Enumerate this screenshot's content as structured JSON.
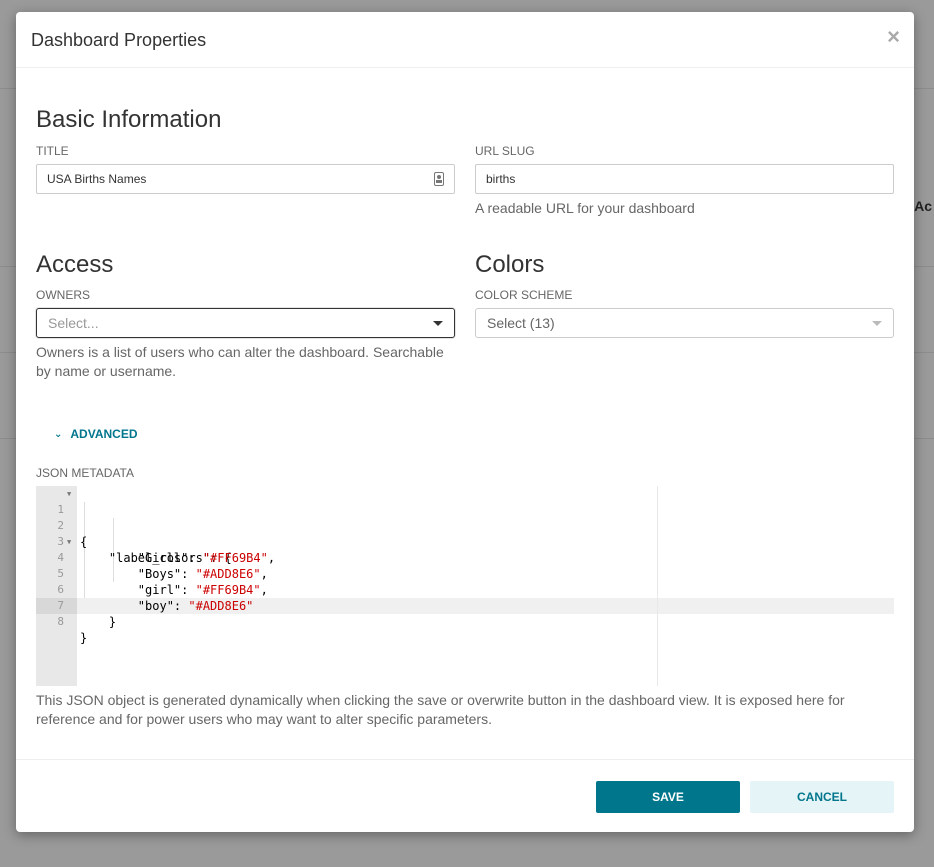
{
  "modal": {
    "title": "Dashboard Properties",
    "close_symbol": "×"
  },
  "background": {
    "partial_text": "Ac"
  },
  "basic_info": {
    "heading": "Basic Information",
    "title_label": "TITLE",
    "title_value": "USA Births Names",
    "slug_label": "URL SLUG",
    "slug_value": "births",
    "slug_help": "A readable URL for your dashboard"
  },
  "access": {
    "heading": "Access",
    "owners_label": "OWNERS",
    "owners_placeholder": "Select...",
    "owners_help": "Owners is a list of users who can alter the dashboard. Searchable by name or username."
  },
  "colors": {
    "heading": "Colors",
    "scheme_label": "COLOR SCHEME",
    "scheme_value": "Select (13)"
  },
  "advanced": {
    "toggle_label": "ADVANCED",
    "json_label": "JSON METADATA",
    "json_lines": [
      "{",
      "    \"label_colors\": {",
      "        \"Girls\": \"#FF69B4\",",
      "        \"Boys\": \"#ADD8E6\",",
      "        \"girl\": \"#FF69B4\",",
      "        \"boy\": \"#ADD8E6\"",
      "    }",
      "}"
    ],
    "json_help": "This JSON object is generated dynamically when clicking the save or overwrite button in the dashboard view. It is exposed here for reference and for power users who may want to alter specific parameters."
  },
  "footer": {
    "save_label": "SAVE",
    "cancel_label": "CANCEL"
  },
  "colors_palette": {
    "accent": "#00768c",
    "accent_light": "#e5f4f7",
    "string": "#cc0000",
    "overlay": "#9a9a9a"
  },
  "icons": {
    "close": "close-icon",
    "contact": "contact-card-icon",
    "caret": "caret-down-icon",
    "chevron": "chevron-down-icon",
    "fold": "fold-arrow-icon"
  }
}
